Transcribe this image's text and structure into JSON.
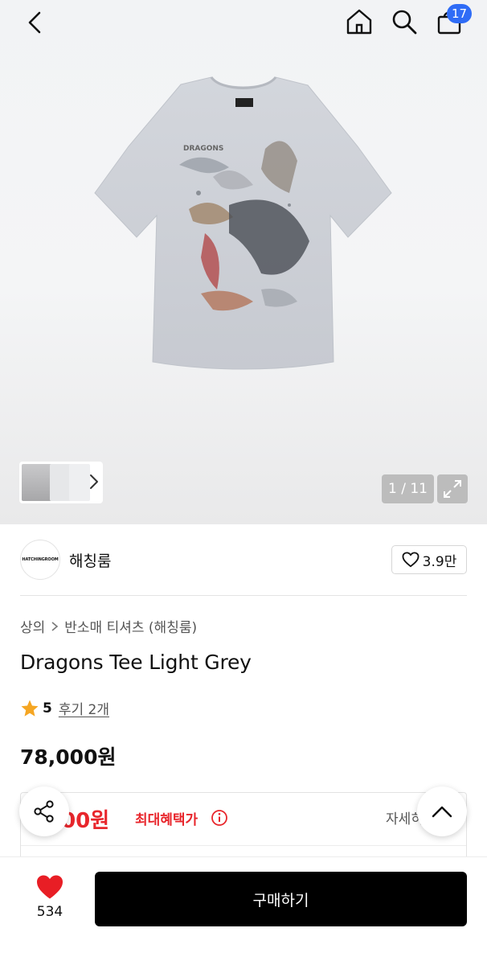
{
  "header": {
    "cart_count": "17",
    "icons": [
      "back-arrow-icon",
      "home-icon",
      "search-icon",
      "shopping-bag-icon"
    ]
  },
  "gallery": {
    "counter": "1 / 11",
    "icons": [
      "chevron-right-icon",
      "expand-icon"
    ]
  },
  "brand": {
    "logo_text": "HATCHINGROOM",
    "name": "해칭룸",
    "likes": "3.9만"
  },
  "breadcrumb": {
    "category": "상의",
    "subcategory": "반소매 티셔츠 (해칭룸)"
  },
  "product": {
    "title": "Dragons Tee Light Grey",
    "rating": "5",
    "reviews": "후기 2개",
    "price": "78,000원"
  },
  "benefit": {
    "price_partial": "000원",
    "label": "최대혜택가",
    "detail": "자세히"
  },
  "bottom": {
    "wish_count": "534",
    "buy_label": "구매하기"
  },
  "colors": {
    "accent_blue": "#2f6cf6",
    "benefit_red": "#e8262c",
    "heart_red": "#e81e25",
    "star_orange": "#f5a623",
    "buy_button": "#000000"
  }
}
